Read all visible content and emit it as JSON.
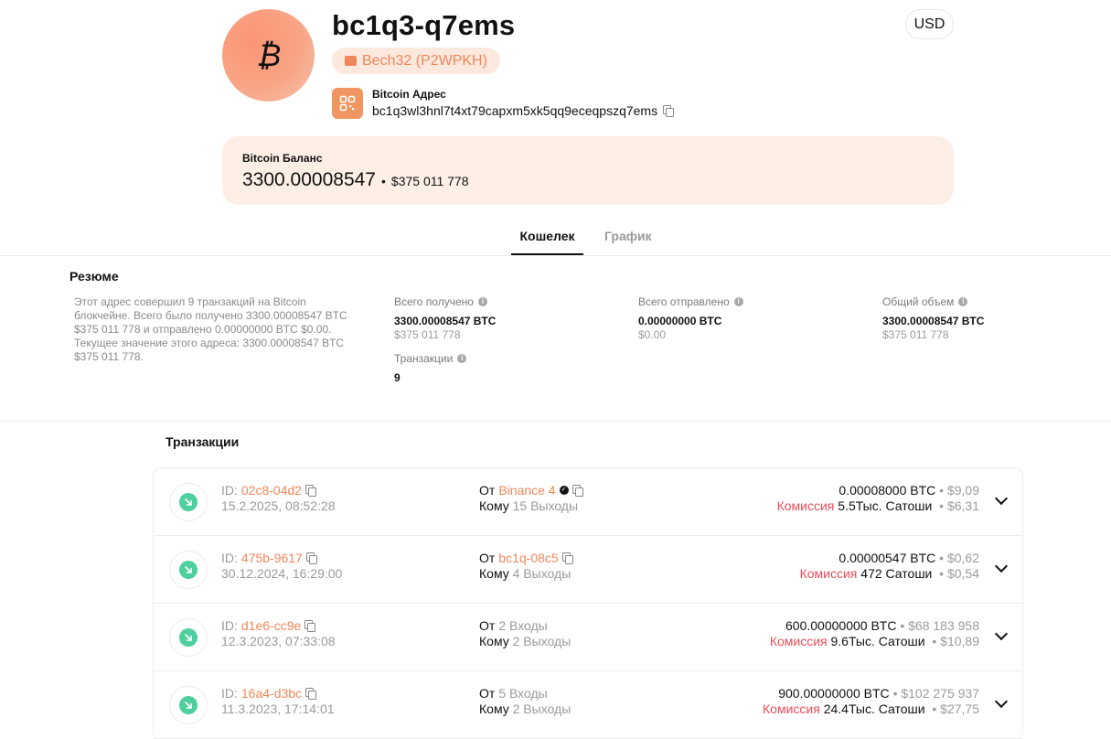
{
  "header": {
    "title": "bc1q3-q7ems",
    "address_type": "Bech32 (P2WPKH)",
    "address_label": "Bitcoin Адрес",
    "address_value": "bc1q3wl3hnl7t4xt79capxm5xk5qq9eceqpszq7ems",
    "currency": "USD",
    "icons": {
      "coin": "bitcoin-icon",
      "wallet": "wallet-icon",
      "qr": "qr-icon",
      "copy": "copy-icon"
    }
  },
  "balance": {
    "label": "Bitcoin Баланс",
    "btc": "3300.00008547",
    "separator": "•",
    "usd": "$375 011 778"
  },
  "tabs": [
    {
      "label": "Кошелек",
      "active": true
    },
    {
      "label": "График",
      "active": false
    }
  ],
  "summary": {
    "title": "Резюме",
    "text": "Этот адрес совершил 9 транзакций на Bitcoin блокчейне. Всего было получено 3300.00008547 BTC $375 011 778 и отправлено 0.00000000 BTC $0.00. Текущее значение этого адреса: 3300.00008547 BTC $375 011 778.",
    "info_glyph": "i",
    "received": {
      "label": "Всего получено",
      "btc": "3300.00008547 BTC",
      "usd": "$375 011 778"
    },
    "sent": {
      "label": "Всего отправлено",
      "btc": "0.00000000 BTC",
      "usd": "$0.00"
    },
    "volume": {
      "label": "Общий объем",
      "btc": "3300.00008547 BTC",
      "usd": "$375 011 778"
    },
    "tx_count": {
      "label": "Транзакции",
      "value": "9"
    }
  },
  "transactions": {
    "title": "Транзакции",
    "id_prefix": "ID:",
    "from_label": "От",
    "to_label": "Кому",
    "fee_label": "Комиссия",
    "dot": "•",
    "colors": {
      "accent": "#f0875a",
      "fee": "#ea4d5a",
      "incoming": "#4fcf9f"
    },
    "items": [
      {
        "id": "02c8-04d2",
        "date": "15.2.2025, 08:52:28",
        "from": "Binance 4",
        "from_verified": true,
        "from_is_link": true,
        "to": "15 Выходы",
        "amount": "0.00008000 BTC",
        "amount_usd": "$9,09",
        "fee": "5.5Тыс. Сатоши",
        "fee_usd": "$6,31"
      },
      {
        "id": "475b-9617",
        "date": "30.12.2024, 16:29:00",
        "from": "bc1q-08c5",
        "from_verified": false,
        "from_is_link": true,
        "to": "4 Выходы",
        "amount": "0.00000547 BTC",
        "amount_usd": "$0,62",
        "fee": "472 Сатоши",
        "fee_usd": "$0,54"
      },
      {
        "id": "d1e6-cc9e",
        "date": "12.3.2023, 07:33:08",
        "from": "2 Входы",
        "from_verified": false,
        "from_is_link": false,
        "to": "2 Выходы",
        "amount": "600.00000000 BTC",
        "amount_usd": "$68 183 958",
        "fee": "9.6Тыс. Сатоши",
        "fee_usd": "$10,89"
      },
      {
        "id": "16a4-d3bc",
        "date": "11.3.2023, 17:14:01",
        "from": "5 Входы",
        "from_verified": false,
        "from_is_link": false,
        "to": "2 Выходы",
        "amount": "900.00000000 BTC",
        "amount_usd": "$102 275 937",
        "fee": "24.4Тыс. Сатоши",
        "fee_usd": "$27,75"
      }
    ]
  }
}
